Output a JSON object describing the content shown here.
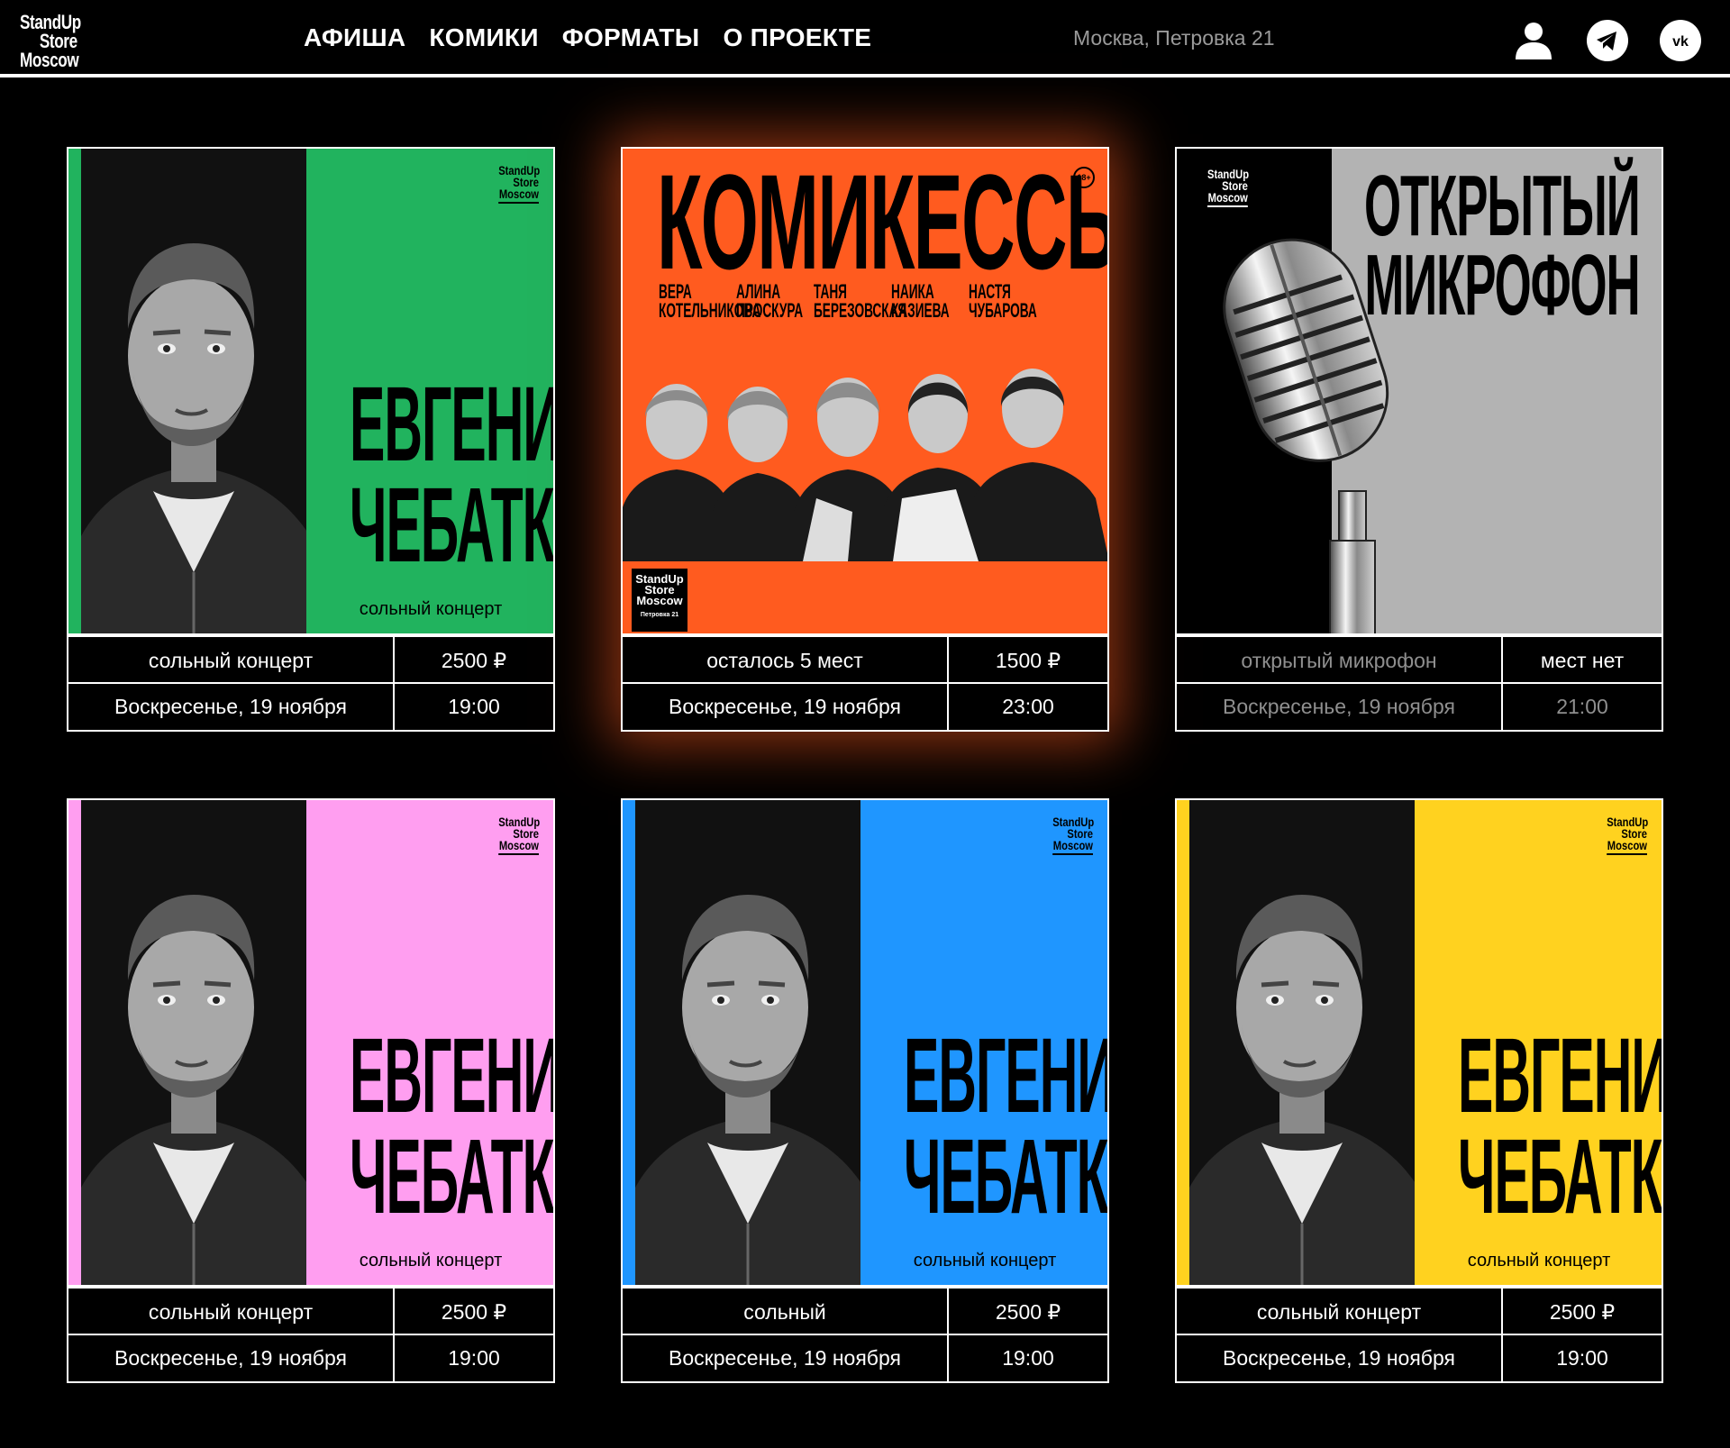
{
  "header": {
    "logo": [
      "StandUp",
      "Store",
      "Moscow"
    ],
    "nav": [
      "АФИША",
      "КОМИКИ",
      "ФОРМАТЫ",
      "О ПРОЕКТЕ"
    ],
    "address": "Москва, Петровка 21",
    "icons": [
      "user-icon",
      "telegram-icon",
      "vk-icon"
    ]
  },
  "cards": [
    {
      "type": "comedian",
      "accent": "#21b35e",
      "name": [
        "ЕВГЕНИЙ",
        "ЧЕБАТКОВ"
      ],
      "subtitle": "сольный концерт",
      "label": "сольный концерт",
      "price": "2500 ₽",
      "date": "Воскресенье, 19 ноября",
      "time": "19:00"
    },
    {
      "type": "komikessy",
      "accent": "#ff5b1f",
      "title": "КОМИКЕССЫ",
      "age": "18+",
      "performers": [
        [
          "ВЕРА",
          "КОТЕЛЬНИКОВА"
        ],
        [
          "АЛИНА",
          "ПРОСКУРА"
        ],
        [
          "ТАНЯ",
          "БЕРЕЗОВСКАЯ"
        ],
        [
          "НАИКА",
          "КАЗИЕВА"
        ],
        [
          "НАСТЯ",
          "ЧУБАРОВА"
        ]
      ],
      "stamp_address": "Петровка 21",
      "label": "осталось 5 мест",
      "price": "1500 ₽",
      "date": "Воскресенье, 19 ноября",
      "time": "23:00"
    },
    {
      "type": "open-mic",
      "accent": "#b3b3b3",
      "title": [
        "ОТКРЫТЫЙ",
        "МИКРОФОН"
      ],
      "label": "открытый микрофон",
      "price": "мест нет",
      "date": "Воскресенье, 19 ноября",
      "time": "21:00"
    },
    {
      "type": "comedian",
      "accent": "#ff9ef0",
      "name": [
        "ЕВГЕНИЙ",
        "ЧЕБАТКОВ"
      ],
      "subtitle": "сольный концерт",
      "label": "сольный концерт",
      "price": "2500 ₽",
      "date": "Воскресенье, 19 ноября",
      "time": "19:00"
    },
    {
      "type": "comedian",
      "accent": "#1f96ff",
      "name": [
        "ЕВГЕНИЙ",
        "ЧЕБАТКОВ"
      ],
      "subtitle": "сольный концерт",
      "label": "сольный",
      "price": "2500 ₽",
      "date": "Воскресенье, 19 ноября",
      "time": "19:00"
    },
    {
      "type": "comedian",
      "accent": "#ffd21f",
      "name": [
        "ЕВГЕНИЙ",
        "ЧЕБАТКОВ"
      ],
      "subtitle": "сольный концерт",
      "label": "сольный концерт",
      "price": "2500 ₽",
      "date": "Воскресенье, 19 ноября",
      "time": "19:00"
    }
  ]
}
